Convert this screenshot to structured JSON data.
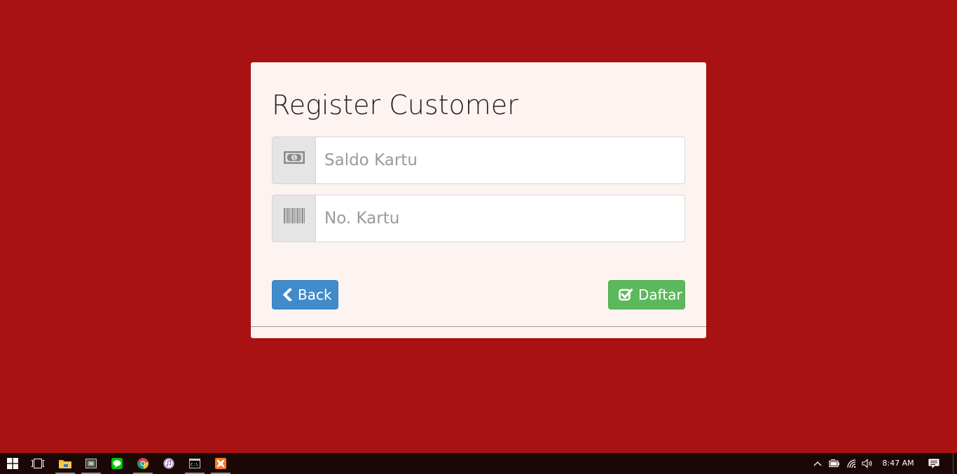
{
  "page": {
    "background_color": "#a81212"
  },
  "form": {
    "title": "Register Customer",
    "saldo": {
      "icon": "money-icon",
      "placeholder": "Saldo Kartu",
      "value": ""
    },
    "kartu": {
      "icon": "barcode-icon",
      "placeholder": "No. Kartu",
      "value": ""
    },
    "back_label": "Back",
    "submit_label": "Daftar",
    "colors": {
      "card_background": "#fdf4f2",
      "back_button": "#428bca",
      "submit_button": "#5cb85c"
    }
  },
  "taskbar": {
    "clock": "8:47 AM",
    "apps": [
      {
        "name": "start-button",
        "icon": "windows-logo-icon"
      },
      {
        "name": "task-view-button",
        "icon": "task-view-icon"
      },
      {
        "name": "file-explorer",
        "icon": "folder-icon",
        "running": true
      },
      {
        "name": "media-player",
        "icon": "window-app-icon",
        "running": true
      },
      {
        "name": "line-messenger",
        "icon": "chat-bubble-icon"
      },
      {
        "name": "chrome-browser",
        "icon": "chrome-icon",
        "running": true
      },
      {
        "name": "itunes",
        "icon": "music-note-icon"
      },
      {
        "name": "command-prompt",
        "icon": "terminal-icon",
        "running": true
      },
      {
        "name": "xampp",
        "icon": "xampp-icon",
        "running": true
      }
    ],
    "tray": [
      "chevron-up-icon",
      "battery-icon",
      "wifi-icon",
      "volume-icon"
    ],
    "notification_icon": "action-center-icon"
  }
}
